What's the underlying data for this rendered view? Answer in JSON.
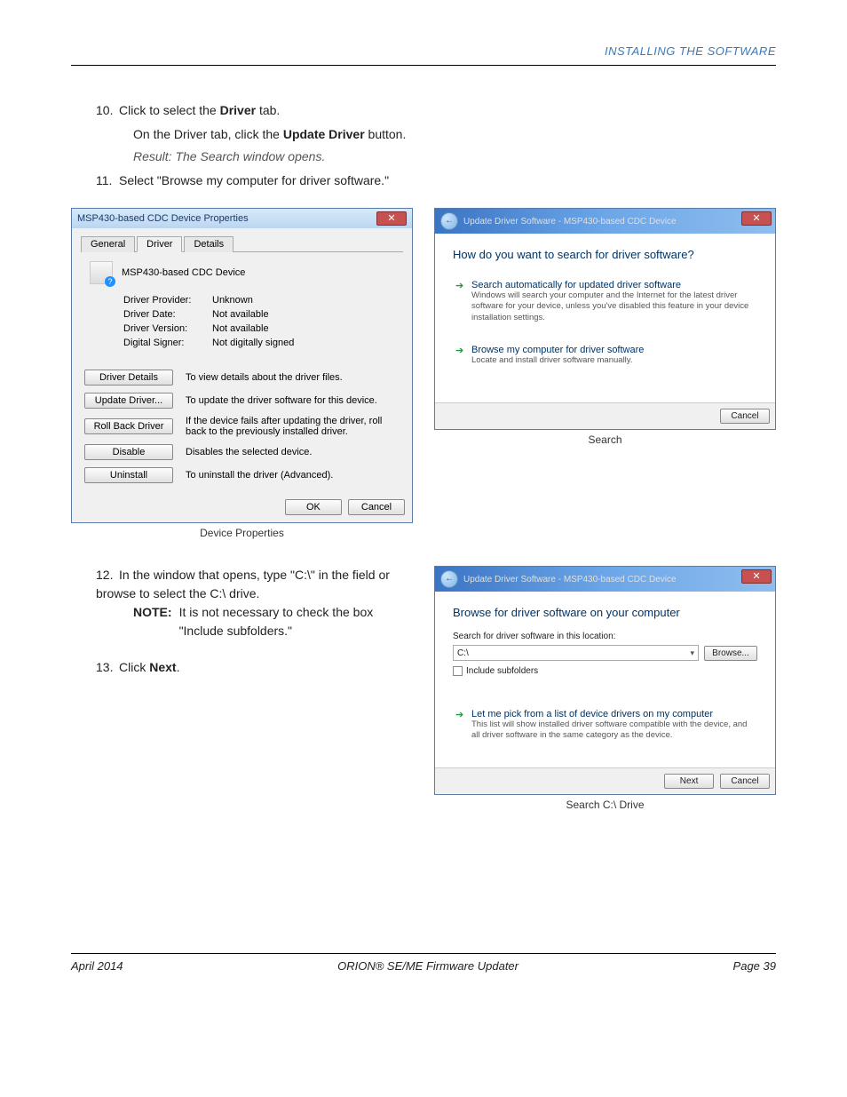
{
  "header": {
    "section_title": "INSTALLING THE SOFTWARE"
  },
  "steps": {
    "s10_num": "10.",
    "s10_text_pre": "Click to select the ",
    "s10_bold": "Driver",
    "s10_text_post": " tab.",
    "s10_sub_pre": "On the Driver tab, click the ",
    "s10_sub_bold": "Update Driver",
    "s10_sub_post": " button.",
    "s10_result": "Result: The Search window opens.",
    "s11_num": "11.",
    "s11_text": "Select \"Browse my computer for driver software.\"",
    "s12_num": "12.",
    "s12_text": "In the window that opens, type \"C:\\\" in the field or browse to select the C:\\ drive.",
    "s12_note_label": "NOTE:",
    "s12_note_text": "It is not necessary to check the box \"Include subfolders.\"",
    "s13_num": "13.",
    "s13_text_pre": "Click ",
    "s13_bold": "Next",
    "s13_text_post": "."
  },
  "fig1": {
    "caption": "Device Properties",
    "title": "MSP430-based CDC Device Properties",
    "tabs": {
      "general": "General",
      "driver": "Driver",
      "details": "Details"
    },
    "device_name": "MSP430-based CDC Device",
    "props": {
      "provider_k": "Driver Provider:",
      "provider_v": "Unknown",
      "date_k": "Driver Date:",
      "date_v": "Not available",
      "version_k": "Driver Version:",
      "version_v": "Not available",
      "signer_k": "Digital Signer:",
      "signer_v": "Not digitally signed"
    },
    "buttons": {
      "details": "Driver Details",
      "details_d": "To view details about the driver files.",
      "update": "Update Driver...",
      "update_d": "To update the driver software for this device.",
      "rollback": "Roll Back Driver",
      "rollback_d": "If the device fails after updating the driver, roll back to the previously installed driver.",
      "disable": "Disable",
      "disable_d": "Disables the selected device.",
      "uninstall": "Uninstall",
      "uninstall_d": "To uninstall the driver (Advanced)."
    },
    "ok": "OK",
    "cancel": "Cancel"
  },
  "fig2": {
    "caption": "Search",
    "title": "Update Driver Software - MSP430-based CDC Device",
    "heading": "How do you want to search for driver software?",
    "opt1_t": "Search automatically for updated driver software",
    "opt1_d": "Windows will search your computer and the Internet for the latest driver software for your device, unless you've disabled this feature in your device installation settings.",
    "opt2_t": "Browse my computer for driver software",
    "opt2_d": "Locate and install driver software manually.",
    "cancel": "Cancel"
  },
  "fig3": {
    "caption": "Search C:\\ Drive",
    "title": "Update Driver Software - MSP430-based CDC Device",
    "heading": "Browse for driver software on your computer",
    "label": "Search for driver software in this location:",
    "path": "C:\\",
    "browse": "Browse...",
    "include": "Include subfolders",
    "opt_t": "Let me pick from a list of device drivers on my computer",
    "opt_d": "This list will show installed driver software compatible with the device, and all driver software in the same category as the device.",
    "next": "Next",
    "cancel": "Cancel"
  },
  "footer": {
    "left": "April 2014",
    "center": "ORION® SE/ME Firmware Updater",
    "right": "Page 39"
  }
}
